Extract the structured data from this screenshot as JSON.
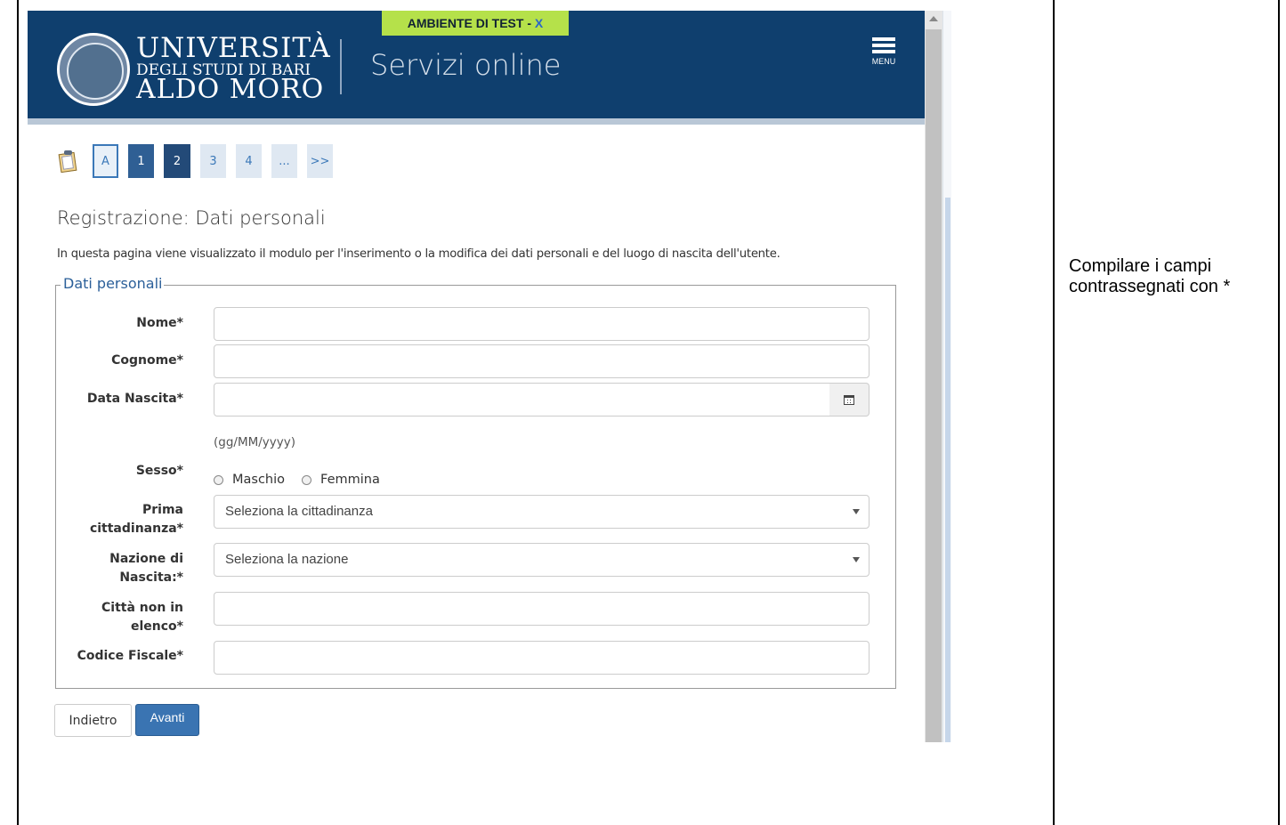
{
  "header": {
    "test_banner": "AMBIENTE DI TEST - ",
    "test_banner_close": "X",
    "university_line1": "UNIVERSITÀ",
    "university_line2": "DEGLI STUDI DI BARI",
    "university_line3": "ALDO MORO",
    "service_title": "Servizi online",
    "menu_label": "MENU",
    "colors": {
      "header_bg": "#0f3f6e",
      "banner_bg": "#b5e14a",
      "accent": "#3a74b2"
    }
  },
  "pager": {
    "steps": [
      "A",
      "1",
      "2",
      "3",
      "4",
      "...",
      ">>"
    ],
    "current": "2"
  },
  "page": {
    "title": "Registrazione: Dati personali",
    "intro": "In questa pagina viene visualizzato il modulo per l'inserimento o la modifica dei dati personali e del luogo di nascita dell'utente."
  },
  "form": {
    "legend": "Dati personali",
    "nome_label": "Nome*",
    "cognome_label": "Cognome*",
    "data_nascita_label": "Data Nascita*",
    "date_hint": "(gg/MM/yyyy)",
    "sesso_label": "Sesso*",
    "sesso_options": [
      "Maschio",
      "Femmina"
    ],
    "cittadinanza_label_1": "Prima",
    "cittadinanza_label_2": "cittadinanza*",
    "cittadinanza_selected": "Seleziona la cittadinanza",
    "nazione_label_1": "Nazione di",
    "nazione_label_2": "Nascita:*",
    "nazione_selected": "Seleziona la nazione",
    "citta_label_1": "Città non in",
    "citta_label_2": "elenco*",
    "cf_label": "Codice Fiscale*",
    "values": {
      "nome": "",
      "cognome": "",
      "data_nascita": "",
      "citta": "",
      "codice_fiscale": ""
    }
  },
  "actions": {
    "back_label": "Indietro",
    "next_label": "Avanti"
  },
  "note": {
    "text": "Compilare i campi contrassegnati con *"
  },
  "icons": [
    "clipboard-icon",
    "calendar-icon",
    "menu-icon",
    "university-seal-icon",
    "chevron-down-icon"
  ]
}
